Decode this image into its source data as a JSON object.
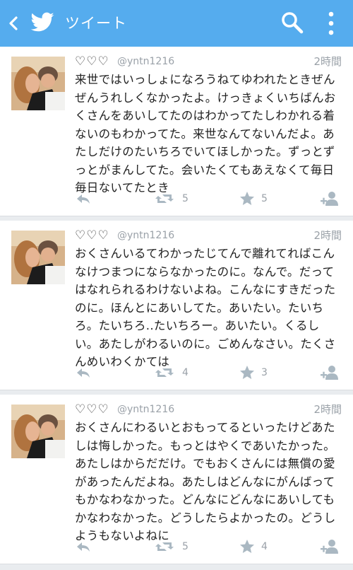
{
  "app_bar": {
    "title": "ツイート",
    "color": "#55acee",
    "icons": [
      "chevron-left-icon",
      "twitter-bird-icon",
      "search-icon",
      "overflow-menu-icon"
    ]
  },
  "tweets": [
    {
      "hearts": "♡♡♡",
      "handle": "@yntn1216",
      "time": "2時間",
      "text": "来世ではいっしょになろうねてゆわれたときぜんぜんうれしくなかったよ。けっきょくいちばんおくさんをあいしてたのはわかってたしわかれる着ないのもわかってた。来世なんてないんだよ。あたしだけのたいちろでいてほしかった。ずっとずっとがまんしてた。会いたくてもあえなくて毎日毎日ないてたとき",
      "retweet_count": "5",
      "favorite_count": "5"
    },
    {
      "hearts": "♡♡♡",
      "handle": "@yntn1216",
      "time": "2時間",
      "text": "おくさんいるてわかったじてんで離れてればこんなけつまつにならなかったのに。なんで。だってはなれられるわけないよね。こんなにすきだったのに。ほんとにあいしてた。あいたい。たいちろ。たいちろ..たいちろー。あいたい。くるしい。あたしがわるいのに。ごめんなさい。たくさんめいわくかては",
      "retweet_count": "4",
      "favorite_count": "3"
    },
    {
      "hearts": "♡♡♡",
      "handle": "@yntn1216",
      "time": "2時間",
      "text": "おくさんにわるいとおもってるといったけどあたしは悔しかった。もっとはやくであいたかった。あたしはからだだけ。でもおくさんには無償の愛があったんだよね。あたしはどんなにがんばってもかなわなかった。どんなにどんなにあいしてもかなわなかった。どうしたらよかったの。どうしようもないよねに",
      "retweet_count": "5",
      "favorite_count": "4"
    }
  ]
}
